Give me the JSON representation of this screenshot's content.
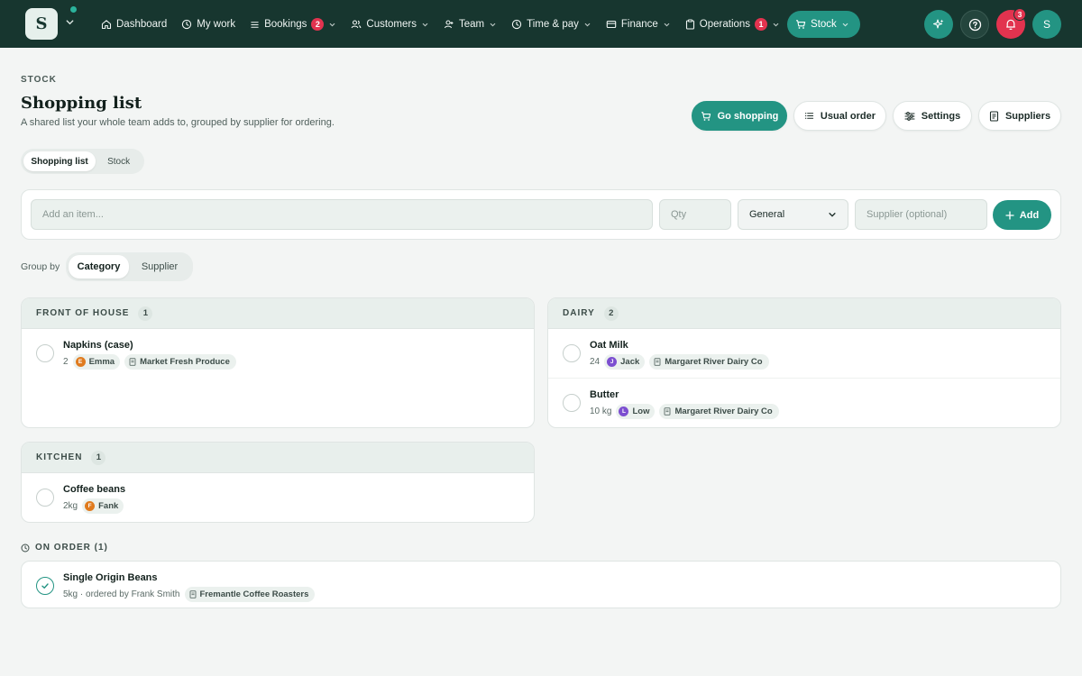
{
  "brand": {
    "logo_letter": "S"
  },
  "nav": {
    "items": [
      {
        "label": "Dashboard",
        "icon": "home-icon"
      },
      {
        "label": "My work",
        "icon": "clock-icon"
      },
      {
        "label": "Bookings",
        "icon": "list-icon",
        "badge": "2"
      },
      {
        "label": "Customers",
        "icon": "users-icon"
      },
      {
        "label": "Team",
        "icon": "team-icon"
      },
      {
        "label": "Time & pay",
        "icon": "clock-icon"
      },
      {
        "label": "Finance",
        "icon": "card-icon"
      },
      {
        "label": "Operations",
        "icon": "clipboard-icon",
        "badge": "1"
      },
      {
        "label": "Stock",
        "icon": "cart-icon",
        "active": true
      }
    ],
    "notifications_count": "3",
    "avatar_letter": "S"
  },
  "header": {
    "eyebrow": "STOCK",
    "title": "Shopping list",
    "subtitle": "A shared list your whole team adds to, grouped by supplier for ordering.",
    "actions": {
      "go_shopping": "Go shopping",
      "usual_order": "Usual order",
      "settings": "Settings",
      "suppliers": "Suppliers"
    }
  },
  "tabs": {
    "shopping_list": "Shopping list",
    "stock": "Stock",
    "active": "Shopping list"
  },
  "add_form": {
    "item_placeholder": "Add an item...",
    "qty_placeholder": "Qty",
    "category_selected": "General",
    "supplier_placeholder": "Supplier (optional)",
    "add_label": "Add"
  },
  "group_by": {
    "label": "Group by",
    "category": "Category",
    "supplier": "Supplier",
    "active": "Category"
  },
  "groups": {
    "front_of_house": {
      "title": "FRONT OF HOUSE",
      "count": "1",
      "items": [
        {
          "name": "Napkins (case)",
          "qty": "2",
          "person": "Emma",
          "initial": "E",
          "supplier": "Market Fresh Produce"
        }
      ]
    },
    "dairy": {
      "title": "DAIRY",
      "count": "2",
      "items": [
        {
          "name": "Oat Milk",
          "qty": "24",
          "person": "Jack",
          "initial": "J",
          "supplier": "Margaret River Dairy Co"
        },
        {
          "name": "Butter",
          "qty": "10 kg",
          "person": "Low",
          "initial": "L",
          "supplier": "Margaret River Dairy Co"
        }
      ]
    },
    "kitchen": {
      "title": "KITCHEN",
      "count": "1",
      "items": [
        {
          "name": "Coffee beans",
          "qty": "2kg",
          "person": "Fank",
          "initial": "F"
        }
      ]
    }
  },
  "on_order": {
    "label": "ON ORDER (1)",
    "items": [
      {
        "name": "Single Origin Beans",
        "detail": "5kg · ordered by Frank Smith",
        "supplier": "Fremantle Coffee Roasters"
      }
    ]
  },
  "colors": {
    "brand_dark": "#17362f",
    "accent": "#239483",
    "badge_red": "#e2334f",
    "avatar_orange": "#e07b1f",
    "avatar_purple": "#7c4fd0"
  }
}
